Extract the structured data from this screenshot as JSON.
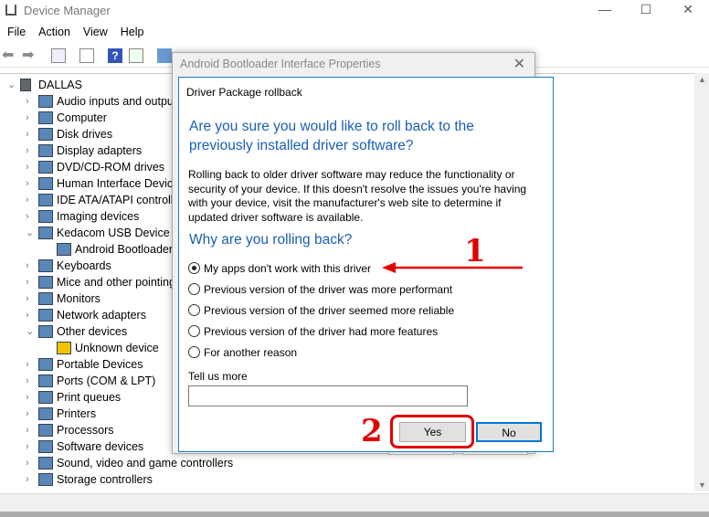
{
  "window": {
    "title": "Device Manager",
    "minimize": "—",
    "maximize": "☐",
    "close": "✕"
  },
  "menu": [
    "File",
    "Action",
    "View",
    "Help"
  ],
  "tree": {
    "root": "DALLAS",
    "items": [
      {
        "label": "Audio inputs and outputs",
        "level": 1,
        "expanded": false
      },
      {
        "label": "Computer",
        "level": 1,
        "expanded": false
      },
      {
        "label": "Disk drives",
        "level": 1,
        "expanded": false
      },
      {
        "label": "Display adapters",
        "level": 1,
        "expanded": false
      },
      {
        "label": "DVD/CD-ROM drives",
        "level": 1,
        "expanded": false
      },
      {
        "label": "Human Interface Devices",
        "level": 1,
        "expanded": false
      },
      {
        "label": "IDE ATA/ATAPI controllers",
        "level": 1,
        "expanded": false
      },
      {
        "label": "Imaging devices",
        "level": 1,
        "expanded": false
      },
      {
        "label": "Kedacom USB Device",
        "level": 1,
        "expanded": true
      },
      {
        "label": "Android Bootloader Interface",
        "level": 2
      },
      {
        "label": "Keyboards",
        "level": 1,
        "expanded": false
      },
      {
        "label": "Mice and other pointing devices",
        "level": 1,
        "expanded": false
      },
      {
        "label": "Monitors",
        "level": 1,
        "expanded": false
      },
      {
        "label": "Network adapters",
        "level": 1,
        "expanded": false
      },
      {
        "label": "Other devices",
        "level": 1,
        "expanded": true
      },
      {
        "label": "Unknown device",
        "level": 2,
        "warning": true
      },
      {
        "label": "Portable Devices",
        "level": 1,
        "expanded": false
      },
      {
        "label": "Ports (COM & LPT)",
        "level": 1,
        "expanded": false
      },
      {
        "label": "Print queues",
        "level": 1,
        "expanded": false
      },
      {
        "label": "Printers",
        "level": 1,
        "expanded": false
      },
      {
        "label": "Processors",
        "level": 1,
        "expanded": false
      },
      {
        "label": "Software devices",
        "level": 1,
        "expanded": false
      },
      {
        "label": "Sound, video and game controllers",
        "level": 1,
        "expanded": false
      },
      {
        "label": "Storage controllers",
        "level": 1,
        "expanded": false
      }
    ]
  },
  "properties": {
    "title": "Android Bootloader Interface Properties",
    "close": "✕"
  },
  "dialog": {
    "header": "Driver Package rollback",
    "question": "Are you sure you would like to roll back to the previously installed driver software?",
    "body": "Rolling back to older driver software may reduce the functionality or security of your device.  If this doesn't resolve the issues you're having with your device, visit the manufacturer's web site to determine if updated driver software is available.",
    "why": "Why are you rolling back?",
    "reasons": [
      {
        "label": "My apps don't work with this driver",
        "selected": true
      },
      {
        "label": "Previous version of the driver was more performant",
        "selected": false
      },
      {
        "label": "Previous version of the driver seemed more reliable",
        "selected": false
      },
      {
        "label": "Previous version of the driver had more features",
        "selected": false
      },
      {
        "label": "For another reason",
        "selected": false
      }
    ],
    "tell_more_label": "Tell us more",
    "tell_more_value": "",
    "yes": "Yes",
    "no": "No"
  },
  "annotations": {
    "step1": "1",
    "step2": "2",
    "color": "#e00000"
  }
}
